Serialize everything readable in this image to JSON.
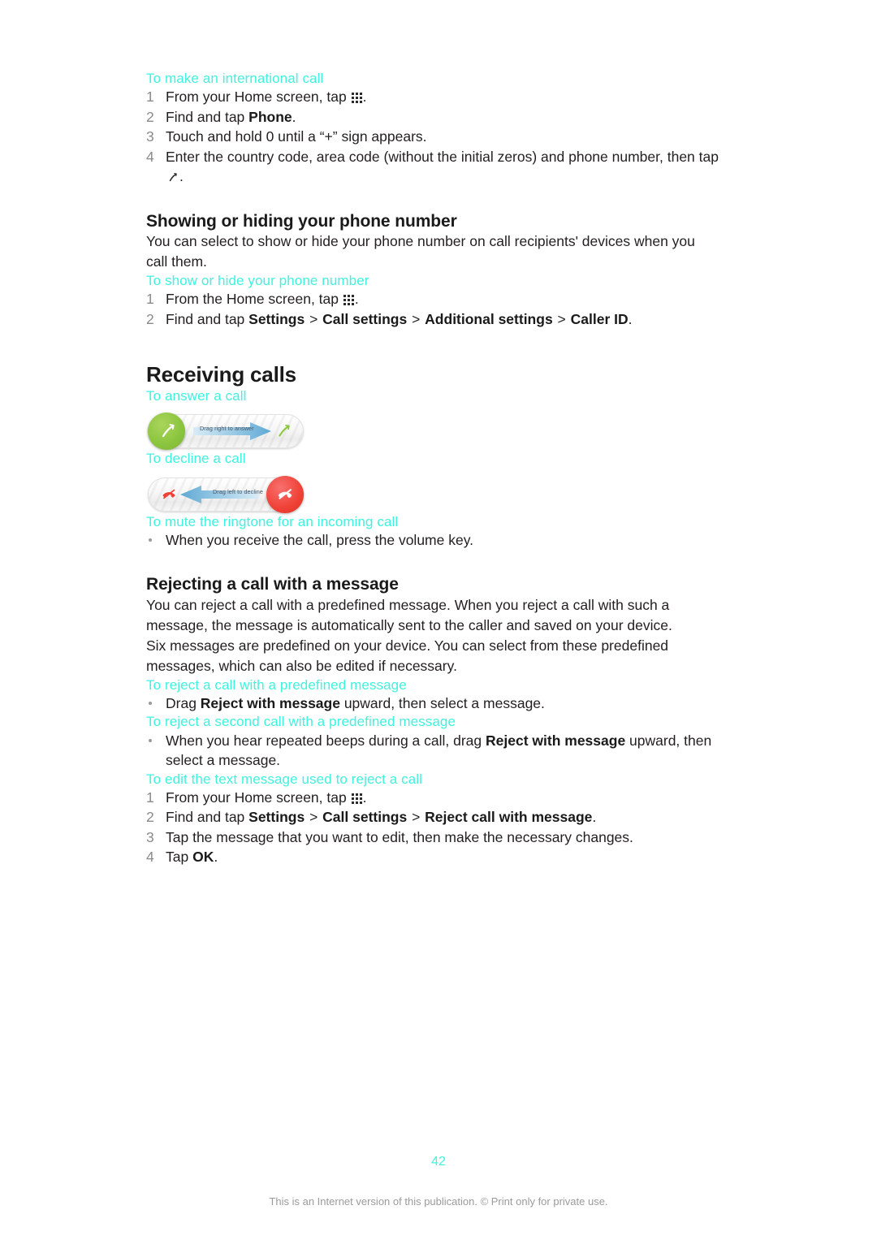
{
  "document": {
    "page_number": "42",
    "footer_note": "This is an Internet version of this publication. © Print only for private use.",
    "accent_color": "#3FF3DE",
    "step_number_color": "#8A8A8A"
  },
  "sections": {
    "international_call": {
      "task_title": "To make an international call",
      "steps": [
        {
          "num": "1",
          "pre": "From your Home screen, tap ",
          "icon": "app-drawer-icon",
          "post": "."
        },
        {
          "num": "2",
          "pre": "Find and tap ",
          "bold": "Phone",
          "post": "."
        },
        {
          "num": "3",
          "text": "Touch and hold 0 until a “+” sign appears."
        },
        {
          "num": "4",
          "pre": "Enter the country code, area code (without the initial zeros) and phone number, then tap ",
          "icon": "phone-handset-icon",
          "post": "."
        }
      ]
    },
    "showing_hiding": {
      "heading": "Showing or hiding your phone number",
      "paragraph": "You can select to show or hide your phone number on call recipients' devices when you call them.",
      "task_title": "To show or hide your phone number",
      "steps": [
        {
          "num": "1",
          "pre": "From the Home screen, tap ",
          "icon": "app-drawer-icon",
          "post": "."
        },
        {
          "num": "2",
          "pre": "Find and tap ",
          "b1": "Settings",
          "sep1": " > ",
          "b2": "Call settings",
          "sep2": " > ",
          "b3": "Additional settings",
          "sep3": " > ",
          "b4": "Caller ID",
          "post": "."
        }
      ]
    },
    "receiving_calls": {
      "heading": "Receiving calls",
      "answer": {
        "task_title": "To answer a call",
        "slider_label": "Drag right to answer",
        "knob_color": "#8CC63F",
        "knob_icon": "phone-handset-icon",
        "end_icon": "phone-handset-icon",
        "arrow_direction": "right"
      },
      "decline": {
        "task_title": "To decline a call",
        "slider_label": "Drag left to decline",
        "knob_color": "#EF4136",
        "knob_icon": "phone-decline-icon",
        "end_icon": "phone-decline-icon",
        "arrow_direction": "left"
      },
      "mute": {
        "task_title": "To mute the ringtone for an incoming call",
        "bullet": "When you receive the call, press the volume key."
      }
    },
    "rejecting": {
      "heading": "Rejecting a call with a message",
      "paragraph_1": "You can reject a call with a predefined message. When you reject a call with such a message, the message is automatically sent to the caller and saved on your device.",
      "paragraph_2": "Six messages are predefined on your device. You can select from these predefined messages, which can also be edited if necessary.",
      "reject_predefined": {
        "task_title": "To reject a call with a predefined message",
        "bullet_pre": "Drag ",
        "bullet_bold": "Reject with message",
        "bullet_post": " upward, then select a message."
      },
      "reject_second": {
        "task_title": "To reject a second call with a predefined message",
        "bullet_pre": "When you hear repeated beeps during a call, drag ",
        "bullet_bold": "Reject with message",
        "bullet_post": " upward, then select a message."
      },
      "edit_text": {
        "task_title": "To edit the text message used to reject a call",
        "steps": [
          {
            "num": "1",
            "pre": "From your Home screen, tap ",
            "icon": "app-drawer-icon",
            "post": "."
          },
          {
            "num": "2",
            "pre": "Find and tap ",
            "b1": "Settings",
            "sep1": " > ",
            "b2": "Call settings",
            "sep2": " > ",
            "b3": "Reject call with message",
            "post": "."
          },
          {
            "num": "3",
            "text": "Tap the message that you want to edit, then make the necessary changes."
          },
          {
            "num": "4",
            "pre": "Tap ",
            "bold": "OK",
            "post": "."
          }
        ]
      }
    }
  }
}
